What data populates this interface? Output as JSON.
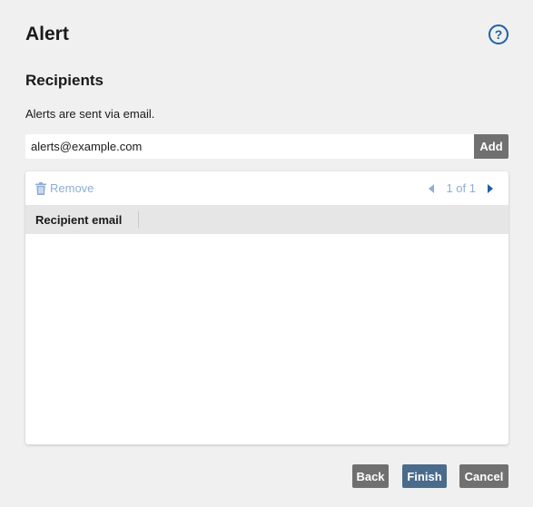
{
  "dialog": {
    "title": "Alert",
    "help_icon": "question-circle-icon",
    "help_glyph": "?"
  },
  "recipients": {
    "heading": "Recipients",
    "description": "Alerts are sent via email.",
    "email_value": "alerts@example.com",
    "add_label": "Add"
  },
  "table": {
    "remove_label": "Remove",
    "remove_icon": "trash-icon",
    "pager_text": "1 of 1",
    "prev_icon": "caret-left-icon",
    "next_icon": "caret-right-icon",
    "columns": [
      "Recipient email"
    ],
    "rows": []
  },
  "footer": {
    "back_label": "Back",
    "finish_label": "Finish",
    "cancel_label": "Cancel"
  },
  "colors": {
    "accent": "#1f5fa8",
    "primary_button": "#4a6b8c",
    "secondary_button": "#707070",
    "disabled_link": "#8eaed6"
  }
}
